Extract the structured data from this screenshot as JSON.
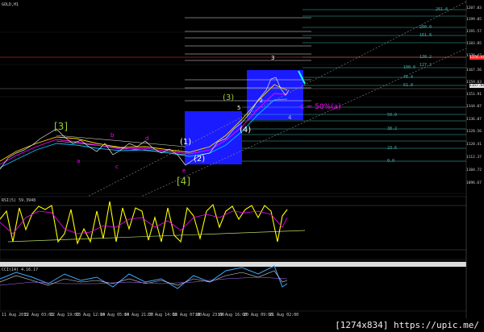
{
  "window": {
    "title": "GOLD,H1",
    "rsi_label": "RSI(5) 59.3948",
    "stoch_label": "CCI(14) 4.16.17",
    "caption": "[1274x834] https://upic.me/"
  },
  "price_axis": [
    "1207.03",
    "1199.05",
    "1191.57",
    "1183.85",
    "1176.47",
    "1167.56",
    "1159.63",
    "1151.91",
    "1144.07",
    "1136.07",
    "1128.56",
    "1120.41",
    "1112.37",
    "1104.72",
    "1096.67"
  ],
  "time_axis": [
    "11 Aug 2015",
    "12 Aug 03:00",
    "12 Aug 19:00",
    "13 Aug 12:00",
    "14 Aug 05:00",
    "14 Aug 21:00",
    "17 Aug 14:00",
    "18 Aug 07:00",
    "18 Aug 23:00",
    "19 Aug 16:00",
    "20 Aug 09:00",
    "21 Aug 02:00"
  ],
  "waves": {
    "w3_big": "[3]",
    "w4_big": "[4]",
    "w1": "(1)",
    "w2": "(2)",
    "w3": "(3)",
    "w4": "(4)",
    "w5": "5",
    "wa": "a",
    "wb": "b",
    "wc": "c",
    "wd": "d",
    "we": "e",
    "w_small_4": "4",
    "w_small_3": "3",
    "w_small_2": "2",
    "note": "c = 50%(a)"
  },
  "price_badges": {
    "current": "1157.64",
    "red": "1176.47"
  },
  "fib_levels": [
    "261.8",
    "200.0",
    "161.8",
    "138.2",
    "127.2",
    "100.0",
    "76.4",
    "61.8",
    "50.0",
    "38.2",
    "23.6",
    "0.0"
  ],
  "colors": {
    "fill_blue": "#1b1bff",
    "fib_white": "#e6e6e6",
    "fib_teal": "#3fb7b0",
    "wave_green": "#9acd32",
    "pink": "#ff00ff",
    "yellow": "#ffff00"
  }
}
